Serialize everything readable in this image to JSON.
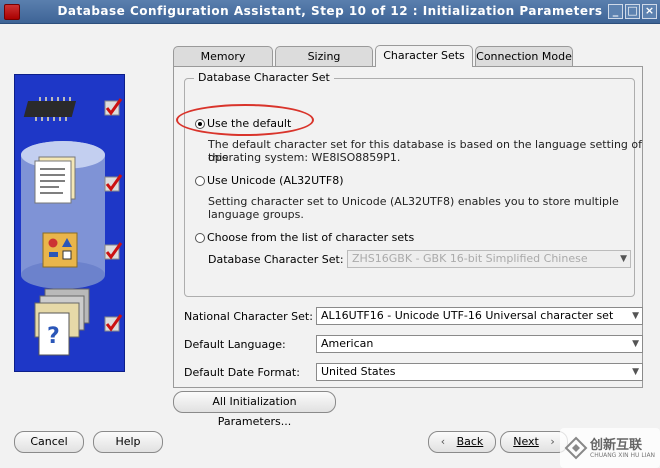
{
  "window": {
    "title": "Database Configuration Assistant, Step 10 of 12 : Initialization Parameters",
    "buttons": [
      "_",
      "□",
      "×"
    ]
  },
  "tabs": [
    {
      "label": "Memory",
      "active": false
    },
    {
      "label": "Sizing",
      "active": false
    },
    {
      "label": "Character Sets",
      "active": true
    },
    {
      "label": "Connection Mode",
      "active": false
    }
  ],
  "charset_group": {
    "title": "Database Character Set",
    "options": [
      {
        "label": "Use the default",
        "selected": true,
        "desc1": "The default character set for this database is based on the language setting of this",
        "desc2": "operating system: WE8ISO8859P1."
      },
      {
        "label": "Use Unicode (AL32UTF8)",
        "selected": false,
        "desc1": "Setting character set to Unicode (AL32UTF8) enables you to store multiple",
        "desc2": "language groups."
      },
      {
        "label": "Choose from the list of character sets",
        "selected": false
      }
    ],
    "db_charset_label": "Database Character Set:",
    "db_charset_value": "ZHS16GBK - GBK 16-bit Simplified Chinese"
  },
  "fields": {
    "national_label": "National Character Set:",
    "national_value": "AL16UTF16 - Unicode UTF-16 Universal character set",
    "language_label": "Default Language:",
    "language_value": "American",
    "dateformat_label": "Default Date Format:",
    "dateformat_value": "United States"
  },
  "buttons": {
    "all_params": "All Initialization Parameters...",
    "cancel": "Cancel",
    "help": "Help",
    "back": "Back",
    "next": "Next"
  },
  "watermark": {
    "cn": "创新互联",
    "en": "CHUANG XIN HU LIAN"
  },
  "colors": {
    "titlebar": "#4a6fa0",
    "image_panel": "#1e37c7",
    "highlight": "#d9342b",
    "check": "#cc1111"
  }
}
